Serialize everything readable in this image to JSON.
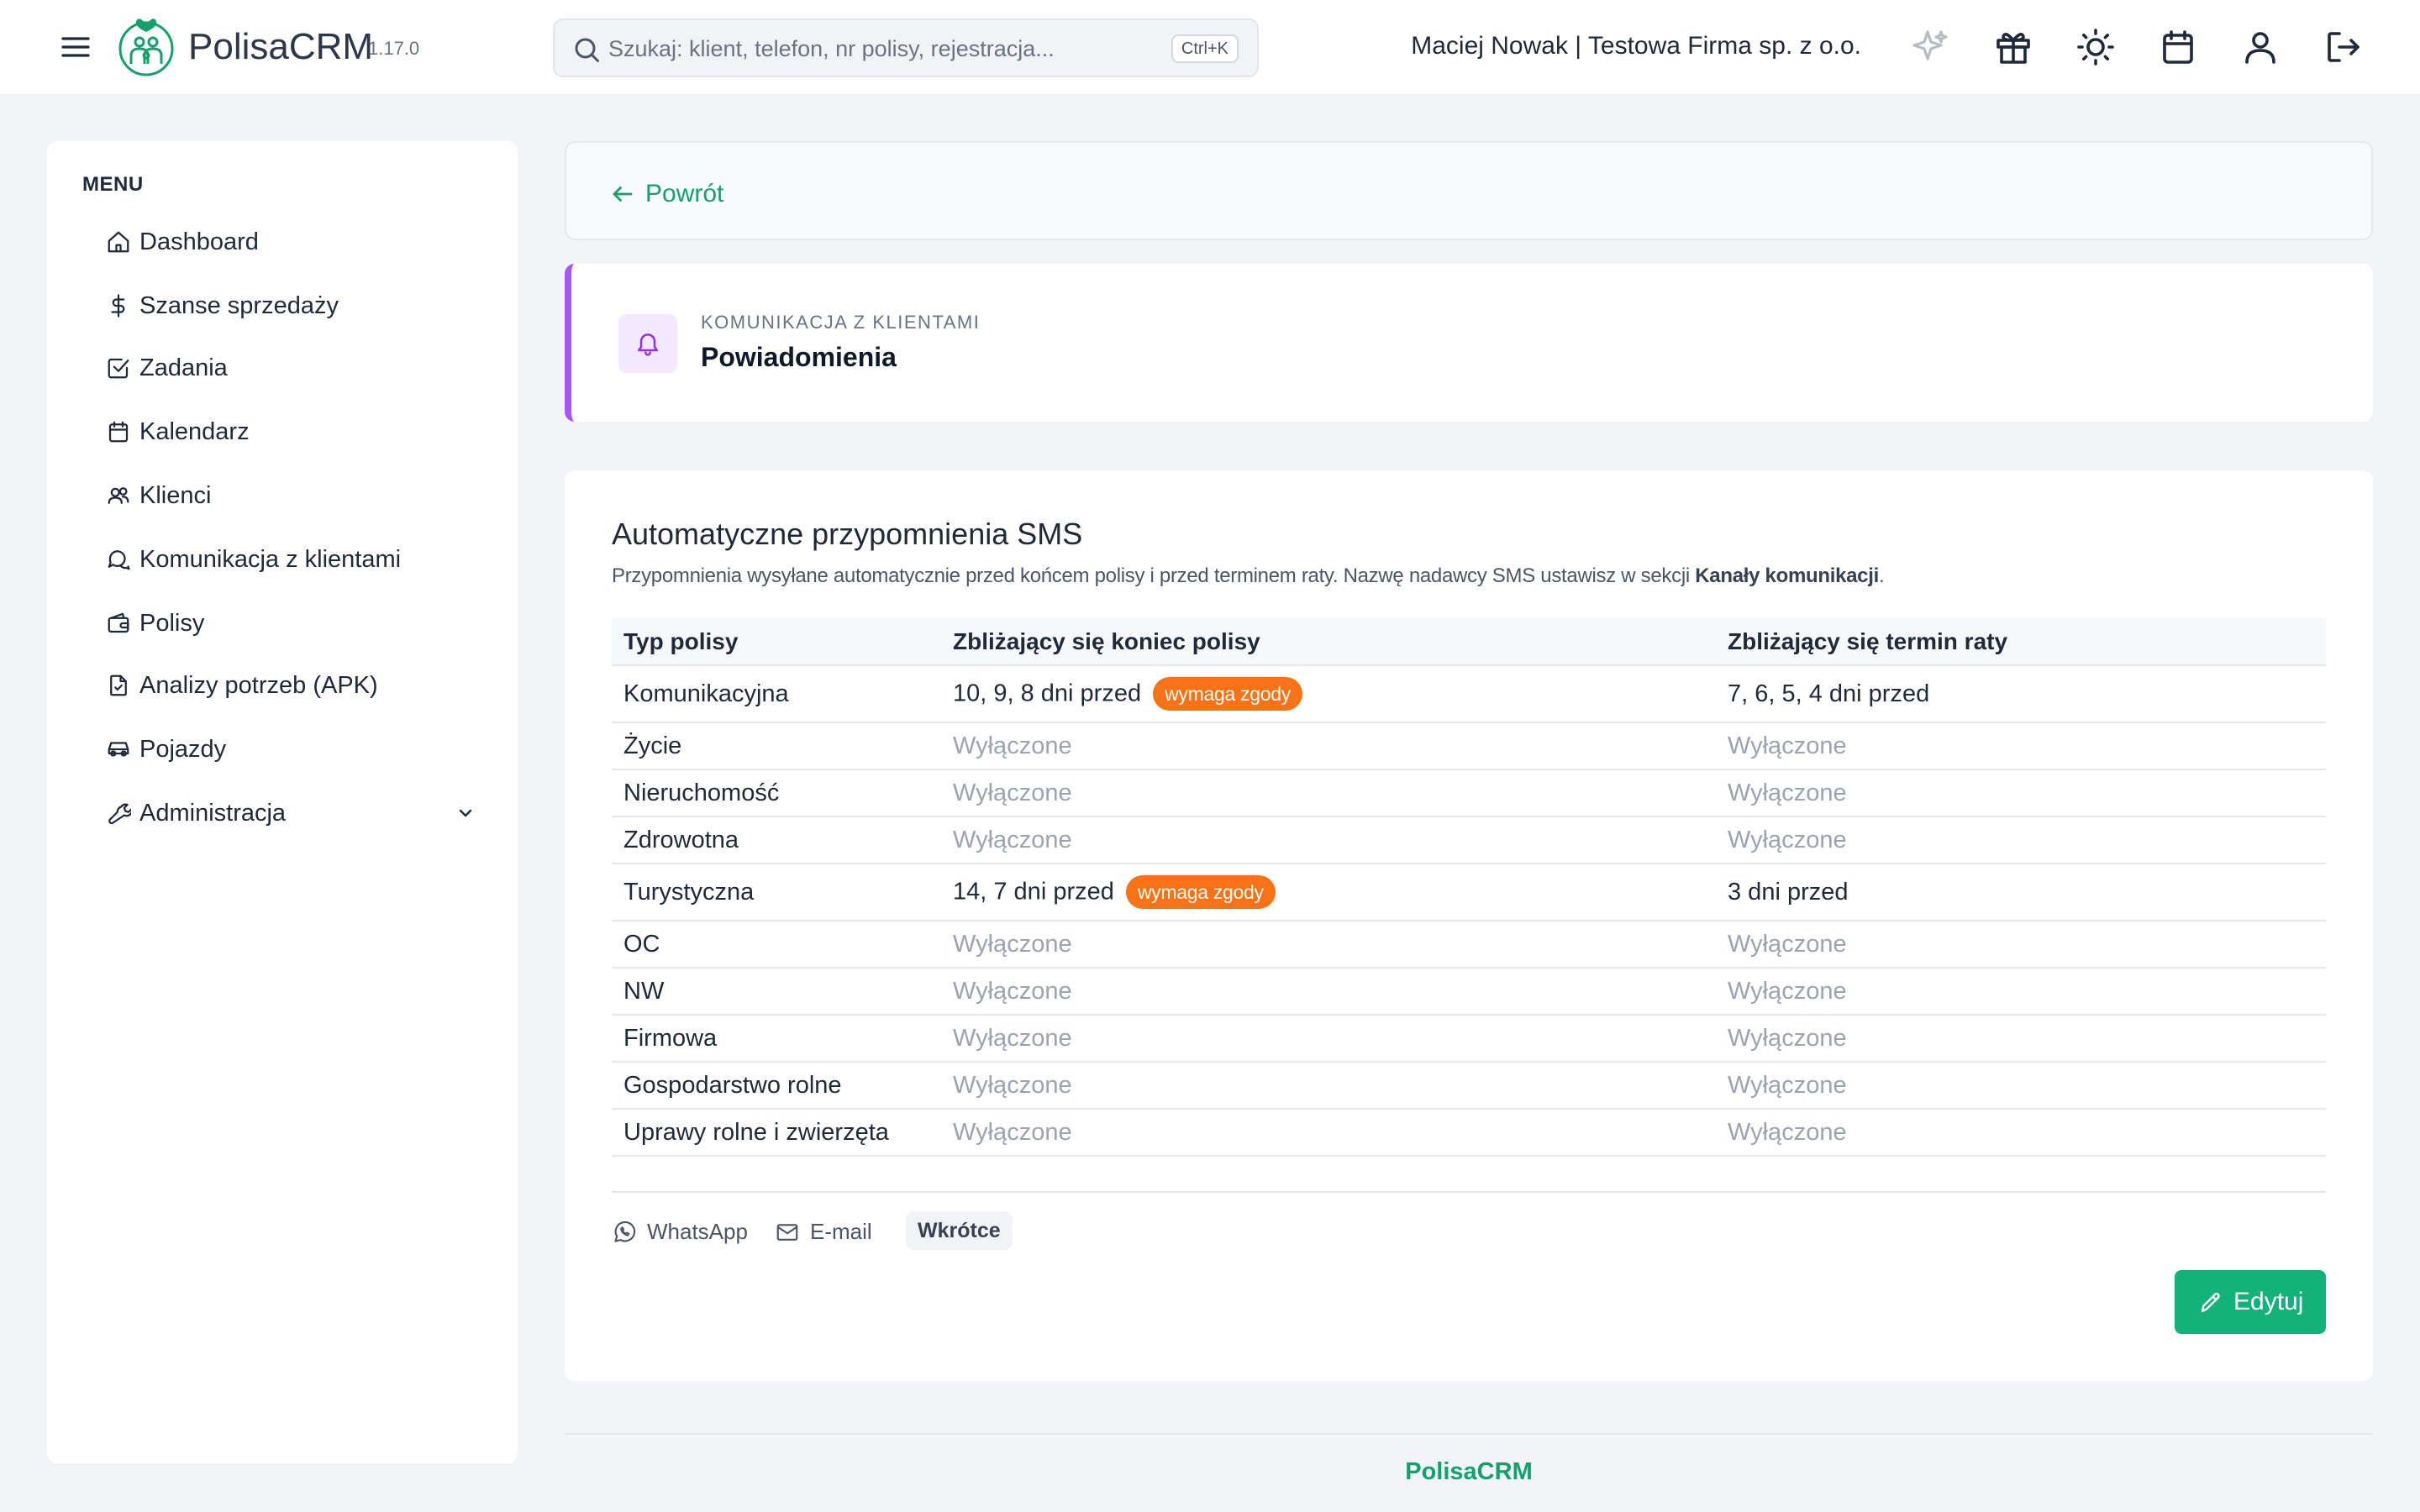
{
  "topbar": {
    "app_name": "PolisaCRM",
    "version": "1.17.0",
    "search_placeholder": "Szukaj: klient, telefon, nr polisy, rejestracja...",
    "search_shortcut": "Ctrl+K",
    "user": "Maciej Nowak | Testowa Firma sp. z o.o.",
    "icons": [
      "menu-icon",
      "sparkles-icon",
      "gift-icon",
      "sun-icon",
      "calendar-icon",
      "user-icon",
      "logout-icon"
    ],
    "brand_color": "#12a06b"
  },
  "sidebar": {
    "title": "MENU",
    "items": [
      {
        "label": "Dashboard",
        "icon": "home-icon"
      },
      {
        "label": "Szanse sprzedaży",
        "icon": "dollar-icon"
      },
      {
        "label": "Zadania",
        "icon": "checkbox-icon"
      },
      {
        "label": "Kalendarz",
        "icon": "calendar-icon"
      },
      {
        "label": "Klienci",
        "icon": "users-icon"
      },
      {
        "label": "Komunikacja z klientami",
        "icon": "chat-icon"
      },
      {
        "label": "Polisy",
        "icon": "wallet-icon"
      },
      {
        "label": "Analizy potrzeb (APK)",
        "icon": "file-check-icon"
      },
      {
        "label": "Pojazdy",
        "icon": "car-icon"
      },
      {
        "label": "Administracja",
        "icon": "wrench-icon"
      }
    ]
  },
  "main": {
    "back_label": "Powrót",
    "header": {
      "overline": "Komunikacja z klientami",
      "title": "Powiadomienia",
      "accent": "#a855f7"
    },
    "section": {
      "title": "Automatyczne przypomnienia SMS",
      "desc_prefix": "Przypomnienia wysyłane automatycznie przed końcem polisy i przed terminem raty. Nazwę nadawcy SMS ustawisz w sekcji ",
      "desc_link": "Kanały komunikacji",
      "desc_suffix": "."
    },
    "table": {
      "headers": [
        "Typ polisy",
        "Zbliżający się koniec polisy",
        "Zbliżający się termin raty"
      ],
      "rows": [
        {
          "type": "Komunikacyjna",
          "end": "10, 9, 8 dni przed",
          "end_badge": "wymaga zgody",
          "installment": "7, 6, 5, 4 dni przed"
        },
        {
          "type": "Życie",
          "end": "Wyłączone",
          "end_badge": "",
          "installment": "Wyłączone"
        },
        {
          "type": "Nieruchomość",
          "end": "Wyłączone",
          "end_badge": "",
          "installment": "Wyłączone"
        },
        {
          "type": "Zdrowotna",
          "end": "Wyłączone",
          "end_badge": "",
          "installment": "Wyłączone"
        },
        {
          "type": "Turystyczna",
          "end": "14, 7 dni przed",
          "end_badge": "wymaga zgody",
          "installment": "3 dni przed"
        },
        {
          "type": "OC",
          "end": "Wyłączone",
          "end_badge": "",
          "installment": "Wyłączone"
        },
        {
          "type": "NW",
          "end": "Wyłączone",
          "end_badge": "",
          "installment": "Wyłączone"
        },
        {
          "type": "Firmowa",
          "end": "Wyłączone",
          "end_badge": "",
          "installment": "Wyłączone"
        },
        {
          "type": "Gospodarstwo rolne",
          "end": "Wyłączone",
          "end_badge": "",
          "installment": "Wyłączone"
        },
        {
          "type": "Uprawy rolne i zwierzęta",
          "end": "Wyłączone",
          "end_badge": "",
          "installment": "Wyłączone"
        }
      ],
      "badge_color": "#f97316"
    },
    "channels": {
      "whatsapp": "WhatsApp",
      "email": "E-mail",
      "soon": "Wkrótce"
    },
    "edit_label": "Edytuj"
  },
  "footer": {
    "brand": "PolisaCRM"
  }
}
